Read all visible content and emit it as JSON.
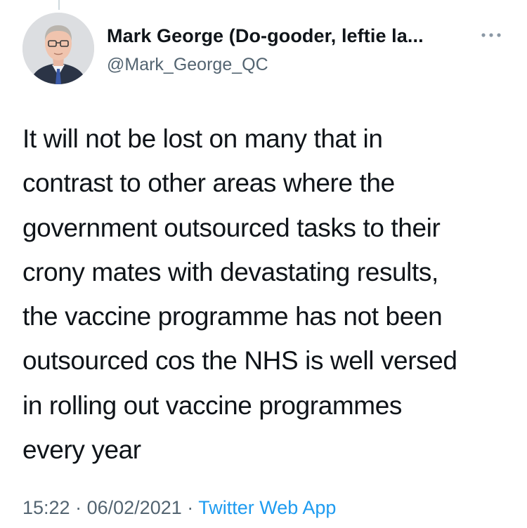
{
  "tweet": {
    "author": {
      "display_name": "Mark George (Do-gooder, leftie la...",
      "handle": "@Mark_George_QC"
    },
    "text_lines": [
      "It will not be lost on many that in",
      "contrast to other areas where the",
      "government outsourced tasks to their",
      "crony mates with devastating results,",
      "the vaccine programme has not been",
      "outsourced cos the NHS is well versed",
      "in rolling out vaccine programmes",
      "every year"
    ],
    "time": "15:22",
    "separator": "·",
    "date": "06/02/2021",
    "source": "Twitter Web App"
  },
  "icons": {
    "more": "more-horizontal-icon",
    "avatar": "profile-photo"
  },
  "colors": {
    "text": "#0f1419",
    "secondary": "#536471",
    "link": "#1d9bf0"
  }
}
